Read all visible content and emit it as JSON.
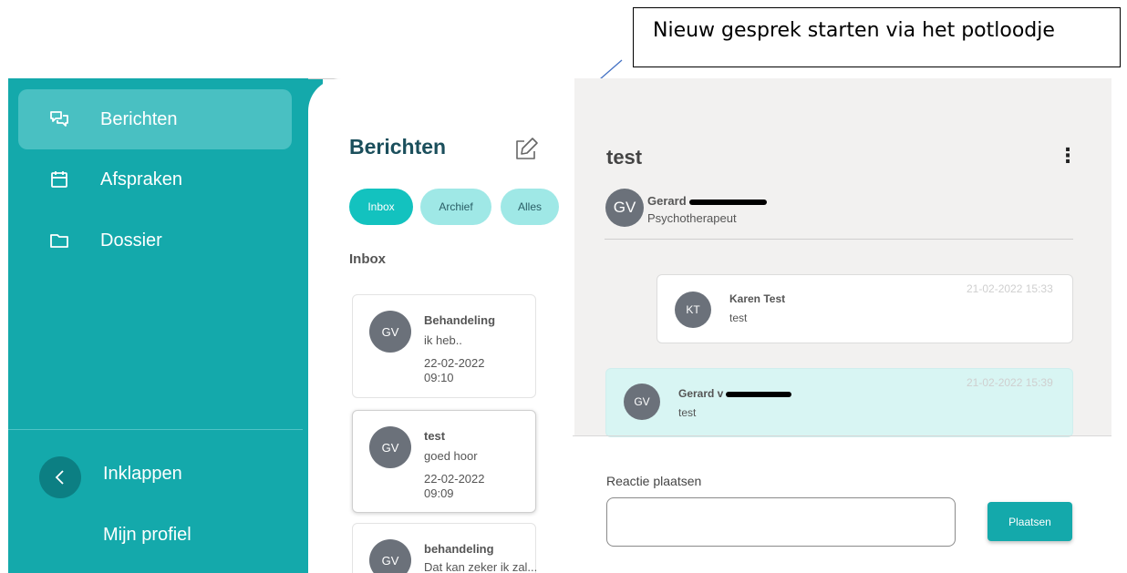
{
  "annotation": {
    "callout_text": "Nieuw gesprek starten via het potloodje"
  },
  "sidebar": {
    "items": [
      {
        "label": "Berichten",
        "icon": "chat-icon"
      },
      {
        "label": "Afspraken",
        "icon": "calendar-icon"
      },
      {
        "label": "Dossier",
        "icon": "folder-icon"
      }
    ],
    "collapse_label": "Inklappen",
    "profile_label": "Mijn profiel"
  },
  "list": {
    "title": "Berichten",
    "filters": [
      "Inbox",
      "Archief",
      "Alles"
    ],
    "section": "Inbox",
    "cards": [
      {
        "initials": "GV",
        "subject": "Behandeling",
        "preview": "ik heb..",
        "date": "22-02-2022",
        "time": "09:10"
      },
      {
        "initials": "GV",
        "subject": "test",
        "preview": "goed hoor",
        "date": "22-02-2022",
        "time": "09:09"
      },
      {
        "initials": "GV",
        "subject": "behandeling",
        "preview": "Dat kan zeker ik zal..."
      }
    ]
  },
  "detail": {
    "title": "test",
    "sender": {
      "initials": "GV",
      "name": "Gerard",
      "role": "Psychotherapeut"
    },
    "messages": [
      {
        "initials": "KT",
        "name": "Karen Test",
        "text": "test",
        "time": "21-02-2022 15:33"
      },
      {
        "initials": "GV",
        "name": "Gerard v",
        "text": "test",
        "time": "21-02-2022 15:39"
      }
    ]
  },
  "reply": {
    "label": "Reactie plaatsen",
    "button": "Plaatsen"
  },
  "colors": {
    "teal": "#14a9ab",
    "teal_active": "#49c0c2",
    "filter_active": "#13c2bf",
    "filter": "#9fe8e6",
    "message_mine": "#d8f5f3"
  }
}
